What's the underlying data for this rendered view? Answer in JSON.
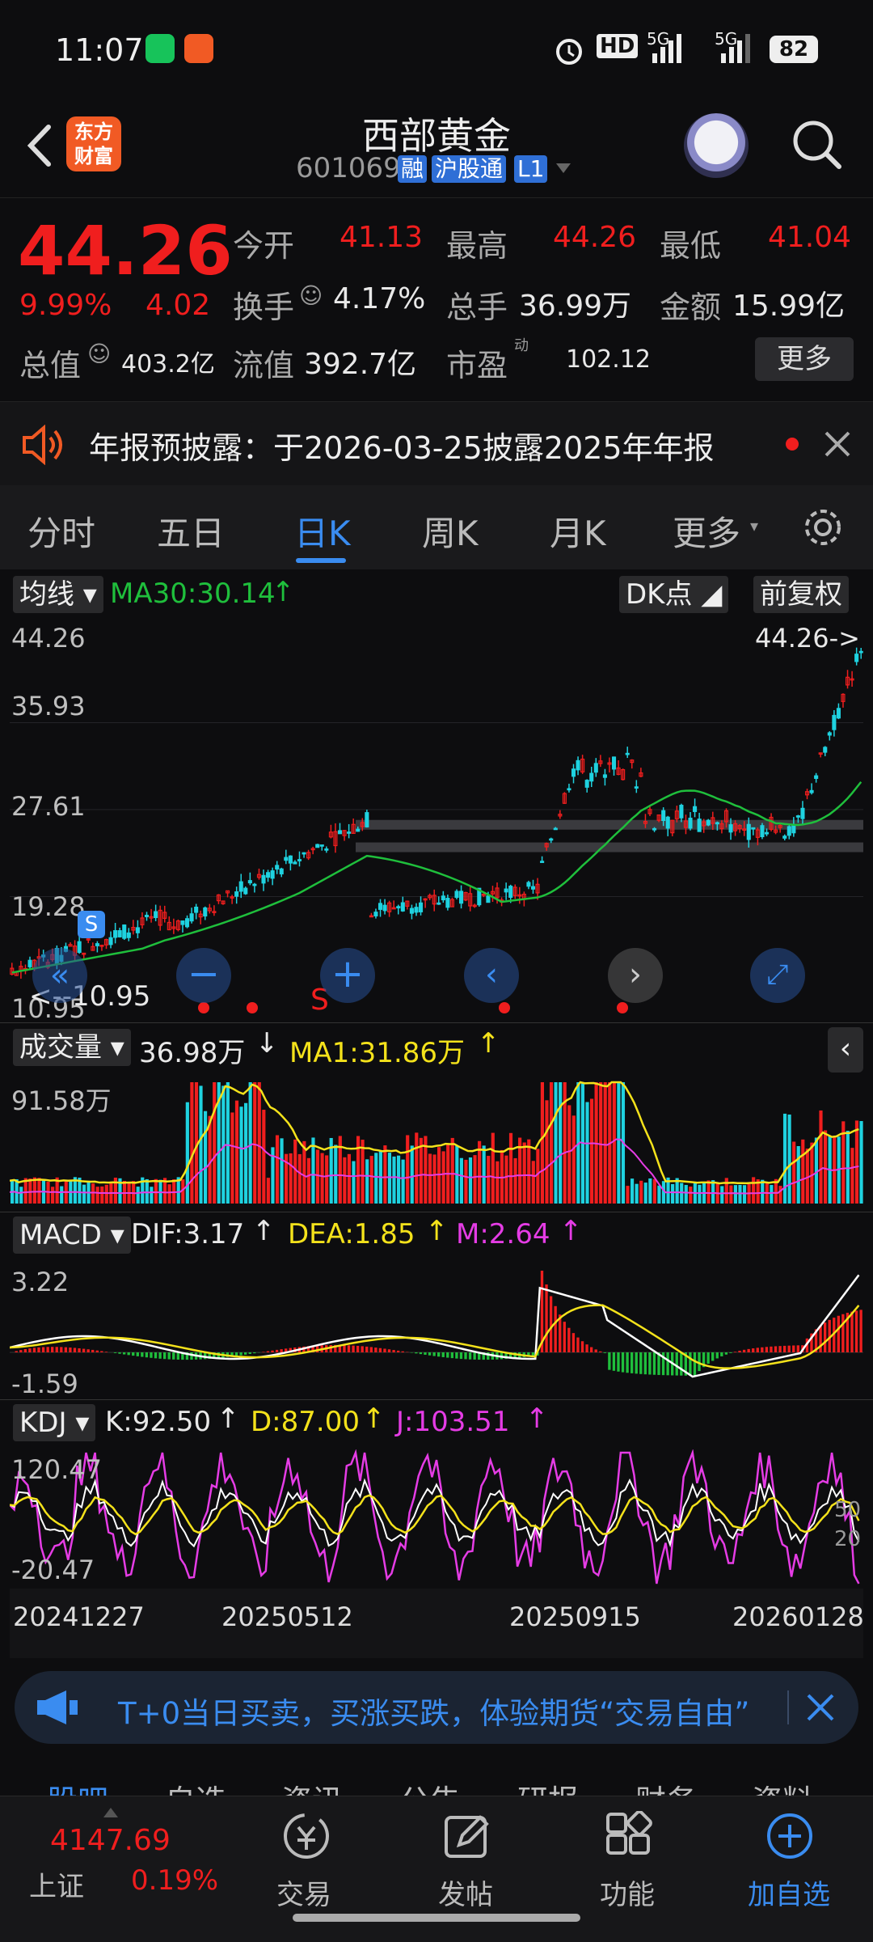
{
  "status_bar": {
    "time": "11:07",
    "battery": "82",
    "hd": "HD",
    "signal1": "5G",
    "signal2": "5G"
  },
  "header": {
    "stock_name": "西部黄金",
    "stock_code": "601069",
    "tags": [
      "融",
      "沪股通",
      "L1"
    ],
    "logo_line1": "东方",
    "logo_line2": "财富"
  },
  "quote": {
    "price": "44.26",
    "change_pct": "9.99%",
    "change": "4.02",
    "open_label": "今开",
    "open": "41.13",
    "high_label": "最高",
    "high": "44.26",
    "low_label": "最低",
    "low": "41.04",
    "turnover_rate_label": "换手",
    "turnover_rate": "4.17%",
    "volume_label": "总手",
    "volume": "36.99万",
    "amount_label": "金额",
    "amount": "15.99亿",
    "total_cap_label": "总值",
    "total_cap": "403.2亿",
    "float_cap_label": "流值",
    "float_cap": "392.7亿",
    "pe_label": "市盈",
    "pe_sup": "动",
    "pe": "102.12",
    "more_label": "更多"
  },
  "notice": {
    "text": "年报预披露：于2026-03-25披露2025年年报"
  },
  "tabs": [
    "分时",
    "五日",
    "日K",
    "周K",
    "月K",
    "更多"
  ],
  "active_tab": "日K",
  "main_chart": {
    "indicator": "均线",
    "ma_label": "MA30:30.14",
    "dk_label": "DK点",
    "adjust_label": "前复权",
    "y_labels": [
      "44.26",
      "35.93",
      "27.61",
      "19.28",
      "10.95"
    ],
    "last_price_tag": "44.26->",
    "low_marker": "<--10.95",
    "s_label": "S"
  },
  "volume": {
    "label": "成交量",
    "value": "36.98万",
    "ma1": "MA1:31.86万",
    "max_label": "91.58万"
  },
  "macd": {
    "label": "MACD",
    "dif": "DIF:3.17",
    "dea": "DEA:1.85",
    "m": "M:2.64",
    "top": "3.22",
    "bottom": "-1.59"
  },
  "kdj": {
    "label": "KDJ",
    "k": "K:92.50",
    "d": "D:87.00",
    "j": "J:103.51",
    "top": "120.47",
    "bottom": "-20.47",
    "lvl50": "50",
    "lvl20": "20"
  },
  "dates": [
    "20241227",
    "20250512",
    "20250915",
    "20260128"
  ],
  "banner": {
    "text": "T+0当日买卖，买涨买跌，体验期货“交易自由”"
  },
  "partial_tabs": [
    "股吧",
    "自选",
    "资讯",
    "公告",
    "研报",
    "财务",
    "资料"
  ],
  "bottom_nav": {
    "index_value": "4147.69",
    "index_name": "上证",
    "index_change": "0.19%",
    "items": [
      "交易",
      "发帖",
      "功能",
      "加自选"
    ]
  },
  "colors": {
    "up": "#f01e1e",
    "down": "#1fbf3c",
    "accent": "#3a8cf0",
    "cyan": "#1fd2e0",
    "yellow": "#f4e21b",
    "magenta": "#e53ce5"
  }
}
